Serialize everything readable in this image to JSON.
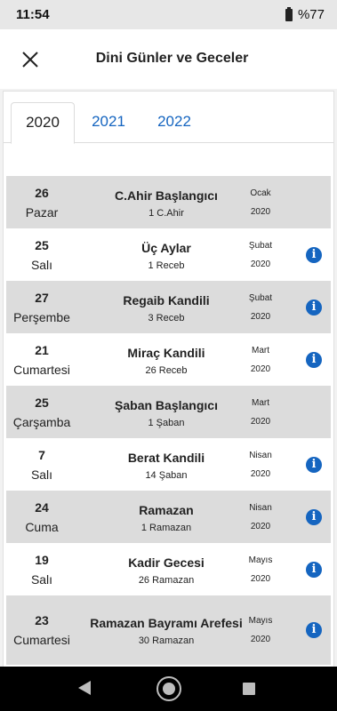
{
  "status": {
    "time": "11:54",
    "battery": "%77"
  },
  "header": {
    "title": "Dini Günler ve Geceler"
  },
  "tabs": [
    "2020",
    "2021",
    "2022"
  ],
  "events": [
    {
      "day": "26",
      "weekday": "Pazar",
      "name": "C.Ahir Başlangıcı",
      "hijri": "1 C.Ahir",
      "month": "Ocak",
      "year": "2020",
      "info": false
    },
    {
      "day": "25",
      "weekday": "Salı",
      "name": "Üç Aylar",
      "hijri": "1 Receb",
      "month": "Şubat",
      "year": "2020",
      "info": true
    },
    {
      "day": "27",
      "weekday": "Perşembe",
      "name": "Regaib Kandili",
      "hijri": "3 Receb",
      "month": "Şubat",
      "year": "2020",
      "info": true
    },
    {
      "day": "21",
      "weekday": "Cumartesi",
      "name": "Miraç Kandili",
      "hijri": "26 Receb",
      "month": "Mart",
      "year": "2020",
      "info": true
    },
    {
      "day": "25",
      "weekday": "Çarşamba",
      "name": "Şaban Başlangıcı",
      "hijri": "1 Şaban",
      "month": "Mart",
      "year": "2020",
      "info": false
    },
    {
      "day": "7",
      "weekday": "Salı",
      "name": "Berat Kandili",
      "hijri": "14 Şaban",
      "month": "Nisan",
      "year": "2020",
      "info": true
    },
    {
      "day": "24",
      "weekday": "Cuma",
      "name": "Ramazan",
      "hijri": "1 Ramazan",
      "month": "Nisan",
      "year": "2020",
      "info": true
    },
    {
      "day": "19",
      "weekday": "Salı",
      "name": "Kadir Gecesi",
      "hijri": "26 Ramazan",
      "month": "Mayıs",
      "year": "2020",
      "info": true
    },
    {
      "day": "23",
      "weekday": "Cumartesi",
      "name": "Ramazan Bayramı Arefesi",
      "hijri": "30 Ramazan",
      "month": "Mayıs",
      "year": "2020",
      "info": true
    }
  ],
  "info_icon": "info-icon",
  "colors": {
    "accent": "#1565c0",
    "shaded_row": "#dcdcdc"
  }
}
